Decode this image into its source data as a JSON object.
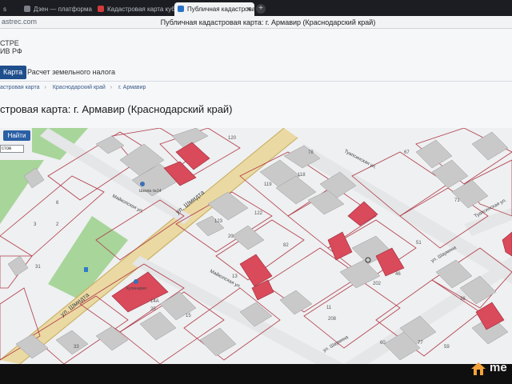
{
  "browser": {
    "tabs": [
      {
        "label": "s"
      },
      {
        "label": "Дзен — платформа для"
      },
      {
        "label": "Кадастровая карта кубан"
      },
      {
        "label": "Публичная кадастровая ка"
      }
    ],
    "new_tab": "+",
    "close": "×",
    "url_fragment": "astrec.com",
    "document_title": "Публичная кадастровая карта: г. Армавир (Краснодарский край)"
  },
  "site": {
    "brand_line1": "СТРЕ",
    "brand_line2": "ИВ РФ",
    "nav": {
      "map": "Карта",
      "land_tax": "Расчет земельного налога"
    },
    "breadcrumbs": [
      "астровая карта",
      "Краснодарский край",
      "г. Армавир"
    ],
    "breadcrumb_sep": "›",
    "heading": "стровая карта: г. Армавир (Краснодарский край)"
  },
  "map": {
    "find_button": "Найти",
    "layer_select": "стов",
    "streets": [
      "ул. Шмидта",
      "ул. Шмидта",
      "Майкопская ул.",
      "Майкопская ул.",
      "Туапсинская ул.",
      "Туапсинская ул.",
      "ул. Шаумяна",
      "ул. Шаумяна"
    ],
    "poi": [
      "Школа №14",
      "Кулинария"
    ],
    "parcel_numbers": [
      "120",
      "78",
      "119",
      "118",
      "123",
      "122",
      "82",
      "20",
      "11",
      "13",
      "14А",
      "25",
      "15",
      "208",
      "202",
      "71",
      "67",
      "31",
      "3",
      "2",
      "6",
      "51",
      "77",
      "60",
      "46",
      "33",
      "36",
      "59"
    ],
    "colors": {
      "building": "#c9c9c9",
      "highlight": "#d94a5a",
      "road": "#ead9a2",
      "green": "#a8d59a",
      "parcel_line": "#b23a4a",
      "background": "#eef0f1"
    }
  },
  "watermark": {
    "text": "me"
  }
}
